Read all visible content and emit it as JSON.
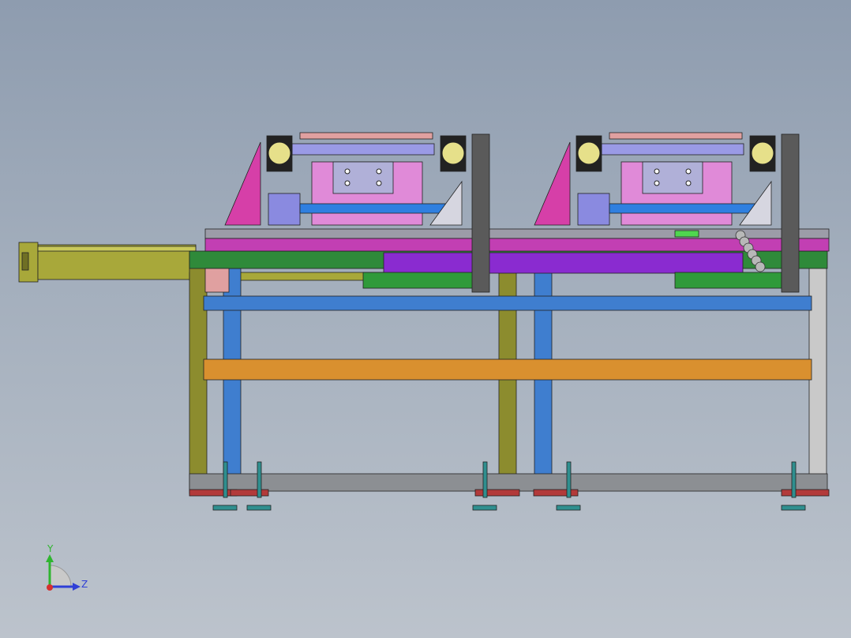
{
  "triad": {
    "y_label": "Y",
    "z_label": "Z"
  },
  "colors": {
    "background_top": "#8e9caf",
    "background_bottom": "#bcc3cc",
    "cylinder": "#a8a83a",
    "cylinder_dark": "#6f6f24",
    "frame_olive": "#8c8c2e",
    "frame_blue": "#3f7ecf",
    "frame_orange": "#d9902f",
    "frame_gray": "#8c8f93",
    "base_red": "#b23a3a",
    "rail_green": "#2f8a3a",
    "rail_magenta": "#c23fb3",
    "slider_purple": "#8a2bd0",
    "foot_teal": "#2f8f8f",
    "plate_pink": "#e08ad8",
    "plate_lavender": "#9a9ae6",
    "roller_blue": "#2f7fe0",
    "bracket_magenta": "#d63fa8",
    "chain_gray": "#b8b8b8",
    "axis_y": "#2fb52f",
    "axis_z": "#2f3fd6",
    "axis_x": "#d62f2f"
  }
}
